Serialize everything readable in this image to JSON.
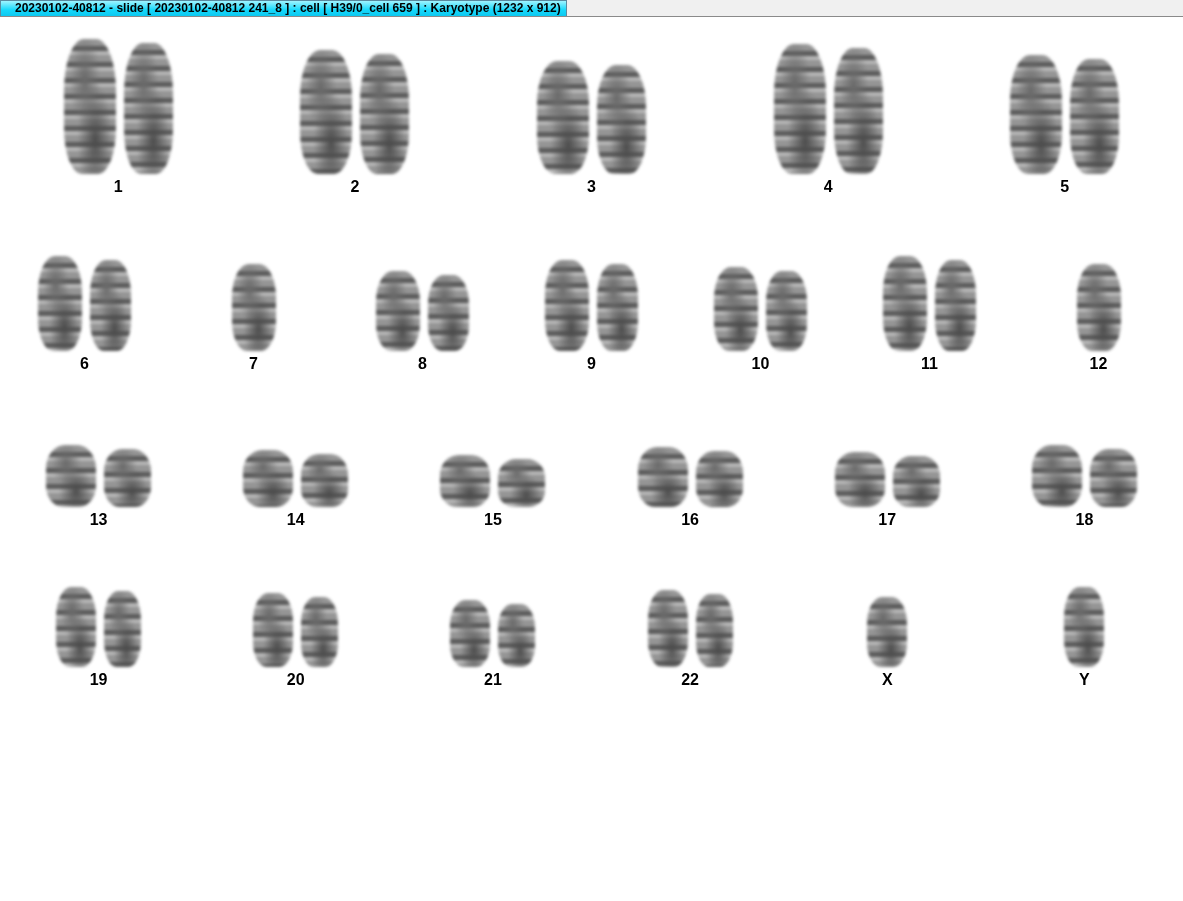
{
  "window": {
    "title": "20230102-40812 - slide [ 20230102-40812 241_8 ] : cell [ H39/0_cell 659 ] : Karyotype  (1232 x 912)"
  },
  "karyotype": {
    "rows": [
      {
        "groups": [
          {
            "label": "1",
            "kind": "pair"
          },
          {
            "label": "2",
            "kind": "pair"
          },
          {
            "label": "3",
            "kind": "pair"
          },
          {
            "label": "4",
            "kind": "pair"
          },
          {
            "label": "5",
            "kind": "pair"
          }
        ]
      },
      {
        "groups": [
          {
            "label": "6",
            "kind": "pair"
          },
          {
            "label": "7",
            "kind": "single"
          },
          {
            "label": "8",
            "kind": "pair"
          },
          {
            "label": "9",
            "kind": "pair"
          },
          {
            "label": "10",
            "kind": "pair"
          },
          {
            "label": "11",
            "kind": "pair"
          },
          {
            "label": "12",
            "kind": "single"
          }
        ]
      },
      {
        "groups": [
          {
            "label": "13",
            "kind": "pair"
          },
          {
            "label": "14",
            "kind": "pair"
          },
          {
            "label": "15",
            "kind": "pair"
          },
          {
            "label": "16",
            "kind": "pair"
          },
          {
            "label": "17",
            "kind": "pair"
          },
          {
            "label": "18",
            "kind": "pair"
          }
        ]
      },
      {
        "groups": [
          {
            "label": "19",
            "kind": "pair"
          },
          {
            "label": "20",
            "kind": "pair"
          },
          {
            "label": "21",
            "kind": "pair"
          },
          {
            "label": "22",
            "kind": "pair"
          },
          {
            "label": "X",
            "kind": "single"
          },
          {
            "label": "Y",
            "kind": "single"
          }
        ]
      }
    ]
  }
}
